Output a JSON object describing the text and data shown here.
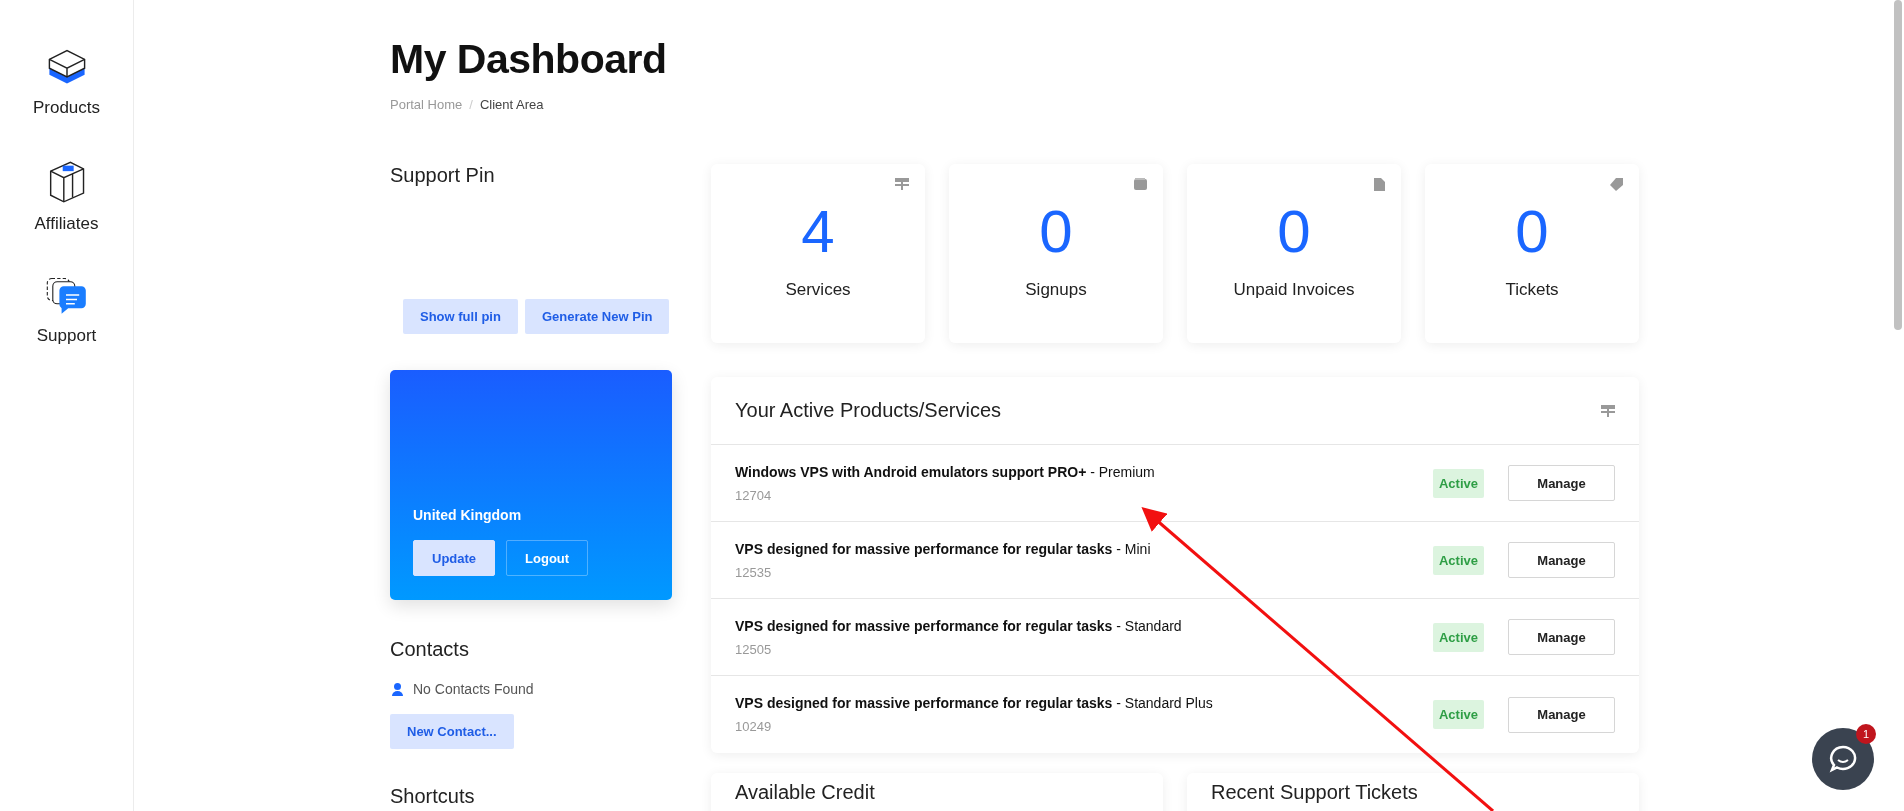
{
  "sidebar": {
    "items": [
      {
        "label": "Products"
      },
      {
        "label": "Affiliates"
      },
      {
        "label": "Support"
      }
    ]
  },
  "header": {
    "title": "My Dashboard",
    "separator": "/",
    "breadcrumb": [
      {
        "label": "Portal Home",
        "current": false
      },
      {
        "label": "Client Area",
        "current": true
      }
    ]
  },
  "support_pin": {
    "title": "Support Pin",
    "buttons": [
      "Show full pin",
      "Generate New Pin"
    ]
  },
  "client_card": {
    "country": "United Kingdom",
    "buttons": [
      {
        "label": "Update",
        "kind": "solid"
      },
      {
        "label": "Logout",
        "kind": "outline"
      }
    ]
  },
  "contacts": {
    "title": "Contacts",
    "empty_text": "No Contacts Found",
    "button": "New Contact..."
  },
  "shortcuts": {
    "title": "Shortcuts"
  },
  "stats": [
    {
      "value": "4",
      "label": "Services"
    },
    {
      "value": "0",
      "label": "Signups"
    },
    {
      "value": "0",
      "label": "Unpaid Invoices"
    },
    {
      "value": "0",
      "label": "Tickets"
    }
  ],
  "products": {
    "title": "Your Active Products/Services",
    "rows": [
      {
        "name": "**Windows VPS with Android emulators support PRO+** - Premium",
        "id": "12704",
        "status": "Active",
        "button": "Manage"
      },
      {
        "name": "**VPS designed for massive performance for regular tasks** - Mini",
        "id": "12535",
        "status": "Active",
        "button": "Manage"
      },
      {
        "name": "**VPS designed for massive performance for regular tasks** - Standard",
        "id": "12505",
        "status": "Active",
        "button": "Manage"
      },
      {
        "name": "**VPS designed for massive performance for regular tasks** - Standard Plus",
        "id": "10249",
        "status": "Active",
        "button": "Manage"
      }
    ]
  },
  "bottom_panels": [
    {
      "title": "Available Credit"
    },
    {
      "title": "Recent Support Tickets"
    }
  ],
  "chat": {
    "badge": "1"
  }
}
